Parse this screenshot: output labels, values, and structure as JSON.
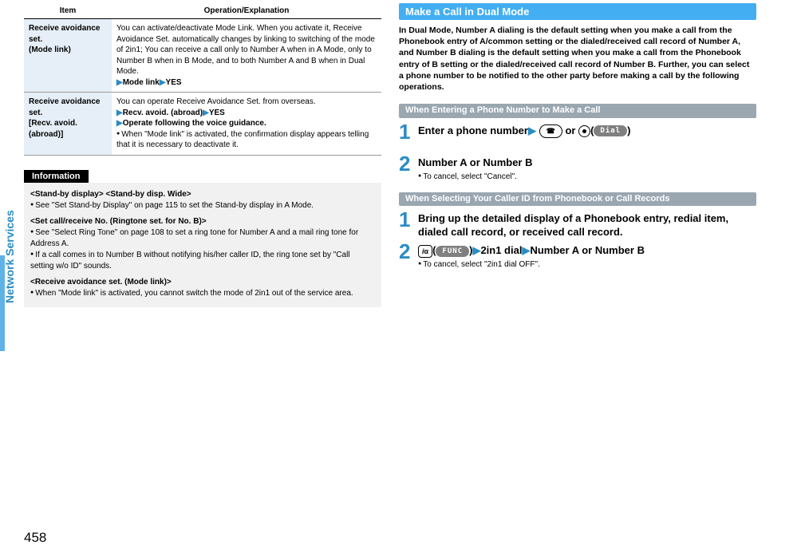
{
  "spine": "Network Services",
  "table": {
    "headers": {
      "item": "Item",
      "op": "Operation/Explanation"
    },
    "rows": [
      {
        "item": "Receive avoidance set.\n(Mode link)",
        "op_l1": "You can activate/deactivate Mode Link. When you activate it, Receive Avoidance Set. automatically changes by linking to switching of the mode of 2in1; You can receive a call only to Number A when in A Mode, only to Number B when in B Mode, and to both Number A and B when in Dual Mode.",
        "op_l2a": "Mode link",
        "op_l2b": "YES"
      },
      {
        "item": "Receive avoidance set.\n[Recv. avoid. (abroad)]",
        "op_l1": "You can operate Receive Avoidance Set. from overseas.",
        "op_l2a": "Recv. avoid. (abroad)",
        "op_l2b": "YES",
        "op_l3": "Operate following the voice guidance.",
        "op_l4": "When \"Mode link\" is activated, the confirmation display appears telling that it is necessary to deactivate it."
      }
    ]
  },
  "info": {
    "title": "Information",
    "b1": {
      "h": "<Stand-by display> <Stand-by disp. Wide>",
      "l1": "See \"Set Stand-by Display\" on page 115 to set the Stand-by display in A Mode."
    },
    "b2": {
      "h": "<Set call/receive No. (Ringtone set. for No. B)>",
      "l1": "See \"Select Ring Tone\" on page 108 to set a ring tone for Number A and a mail ring tone for Address A.",
      "l2": "If a call comes in to Number B without notifying his/her caller ID, the ring tone set by \"Call setting w/o ID\" sounds."
    },
    "b3": {
      "h": "<Receive avoidance set. (Mode link)>",
      "l1": "When \"Mode link\" is activated, you cannot switch the mode of 2in1 out of the service area."
    }
  },
  "right": {
    "title": "Make a Call in Dual Mode",
    "intro": "In Dual Mode, Number A dialing is the default setting when you make a call from the Phonebook entry of A/common setting or the dialed/received call record of Number A, and Number B dialing is the default setting when you make a call from the Phonebook entry of B setting or the dialed/received call record of Number B. Further, you can select a phone number to be notified to the other party before making a call by the following operations.",
    "sub1": "When Entering a Phone Number to Make a Call",
    "s1": {
      "head_a": "Enter a phone number",
      "or": " or ",
      "pill": "Dial",
      "num": "1"
    },
    "s2": {
      "num": "2",
      "head": "Number A or Number B",
      "note": "To cancel, select \"Cancel\"."
    },
    "sub2": "When Selecting Your Caller ID from Phonebook or Call Records",
    "s3": {
      "num": "1",
      "head": "Bring up the detailed display of a Phonebook entry, redial item, dialed call record, or received call record."
    },
    "s4": {
      "num": "2",
      "pill": "FUNC",
      "t1": "2in1 dial",
      "t2": "Number A or Number B",
      "note": "To cancel, select \"2in1 dial OFF\"."
    }
  },
  "page_number": "458"
}
